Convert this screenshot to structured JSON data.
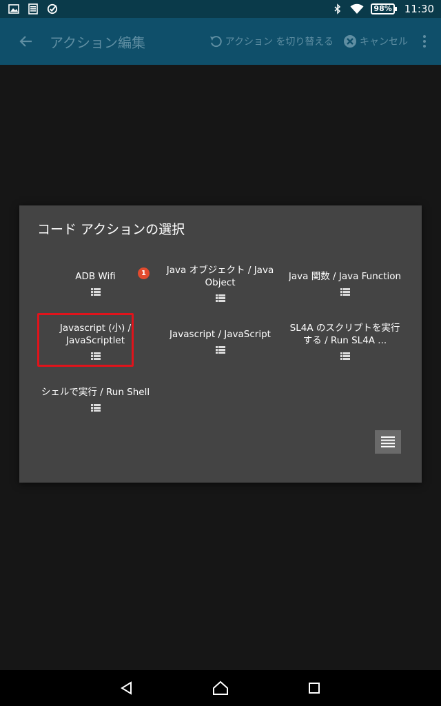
{
  "status_bar": {
    "left_icons": [
      "image-icon",
      "document-icon",
      "check-circle-icon"
    ],
    "right_icons": [
      "bluetooth-icon",
      "wifi-icon"
    ],
    "battery": "98%",
    "time": "11:30"
  },
  "toolbar": {
    "title": "アクション編集",
    "switch_action_label": "アクション を切り替える",
    "cancel_label": "キャンセル"
  },
  "dialog": {
    "title": "コード アクションの選択",
    "items": [
      {
        "label": "ADB Wifi",
        "badge": "1"
      },
      {
        "label": "Java オブジェクト / Java Object"
      },
      {
        "label": "Java 関数 / Java Function"
      },
      {
        "label": "Javascript (小) / JavaScriptlet",
        "selected": true
      },
      {
        "label": "Javascript / JavaScript"
      },
      {
        "label": "SL4A のスクリプトを実行する / Run SL4A ..."
      },
      {
        "label": "シェルで実行 / Run Shell"
      }
    ]
  },
  "colors": {
    "status_bar": "#0a3a4a",
    "toolbar": "#0f4f6a",
    "dialog": "#444444",
    "badge": "#e24b2e",
    "selection_border": "#e0131b"
  }
}
